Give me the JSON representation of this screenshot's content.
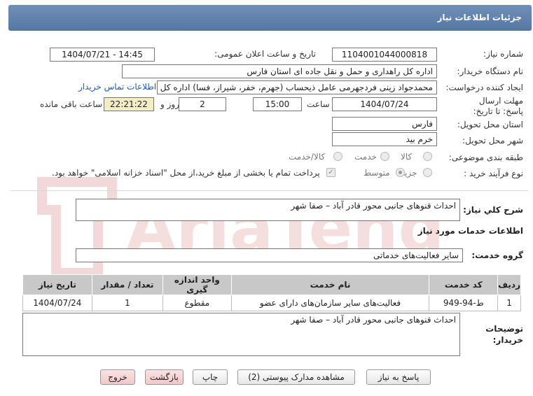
{
  "header": {
    "title": "جزئیات اطلاعات نیاز"
  },
  "fields": {
    "need_number_label": "شماره نیاز:",
    "need_number": "1104001044000818",
    "announce_label": "تاریخ و ساعت اعلان عمومی:",
    "announce_value": "1404/07/21 - 14:45",
    "buyer_org_label": "نام دستگاه خریدار:",
    "buyer_org": "اداره کل راهداری و حمل و نقل جاده ای استان فارس",
    "requester_label": "ایجاد کننده درخواست:",
    "requester": "محمدجواد زینی فردجهرمی عامل ذیحساب (جهرم، خفر، شیراز، فسا) اداره کل ر",
    "contact_link": "اطلاعات تماس خریدار",
    "deadline_label": "مهلت ارسال پاسخ: تا تاریخ:",
    "deadline_date": "1404/07/24",
    "time_label": "ساعت",
    "deadline_time": "15:00",
    "days_value": "2",
    "days_label": "روز و",
    "remaining_time": "22:21:22",
    "remaining_label": "ساعت باقی مانده",
    "province_label": "استان محل تحویل:",
    "province": "فارس",
    "city_label": "شهر محل تحویل:",
    "city": "خرم بید",
    "category_label": "طبقه بندی موضوعی:",
    "category_options": [
      "کالا",
      "خدمت",
      "کالا/خدمت"
    ],
    "process_label": "نوع فرآیند خرید :",
    "process_options": [
      "جزیی",
      "متوسط"
    ],
    "payment_note": "پرداخت تمام یا بخشی از مبلغ خرید،از محل \"اسناد خزانه اسلامی\" خواهد بود."
  },
  "description": {
    "label": "شرح کلي نياز:",
    "value": "احداث قنوهای جانبی محور قادر آباد – صفا شهر"
  },
  "services_title": "اطلاعات خدمات مورد نياز",
  "service_group": {
    "label": "گروه خدمت:",
    "value": "ساير فعاليت‌هاى خدماتى"
  },
  "table": {
    "headers": [
      "ردیف",
      "کد خدمت",
      "نام خدمت",
      "واحد اندازه گیری",
      "تعداد / مقدار",
      "تاریخ نیاز"
    ],
    "rows": [
      [
        "1",
        "ط-94-949",
        "فعالیت‌های سایر سازمان‌های دارای عضو",
        "مقطوع",
        "1",
        "1404/07/24"
      ]
    ]
  },
  "buyer_notes": {
    "label": "توضیحات خریدار:",
    "value": "احداث قنوهای جانبی محور قادر آباد – صفا شهر"
  },
  "buttons": {
    "reply": "پاسخ به نیاز",
    "docs": "مشاهده مدارک پیوستی (2)",
    "print": "چاپ",
    "back": "بازگشت",
    "exit": "خروج"
  },
  "watermark": "AriaTender.neT",
  "colors": {
    "header": "#6383ad",
    "link": "#1a5bc4",
    "remaining_bg": "#f2edc4",
    "watermark": "#f3d4d4"
  }
}
